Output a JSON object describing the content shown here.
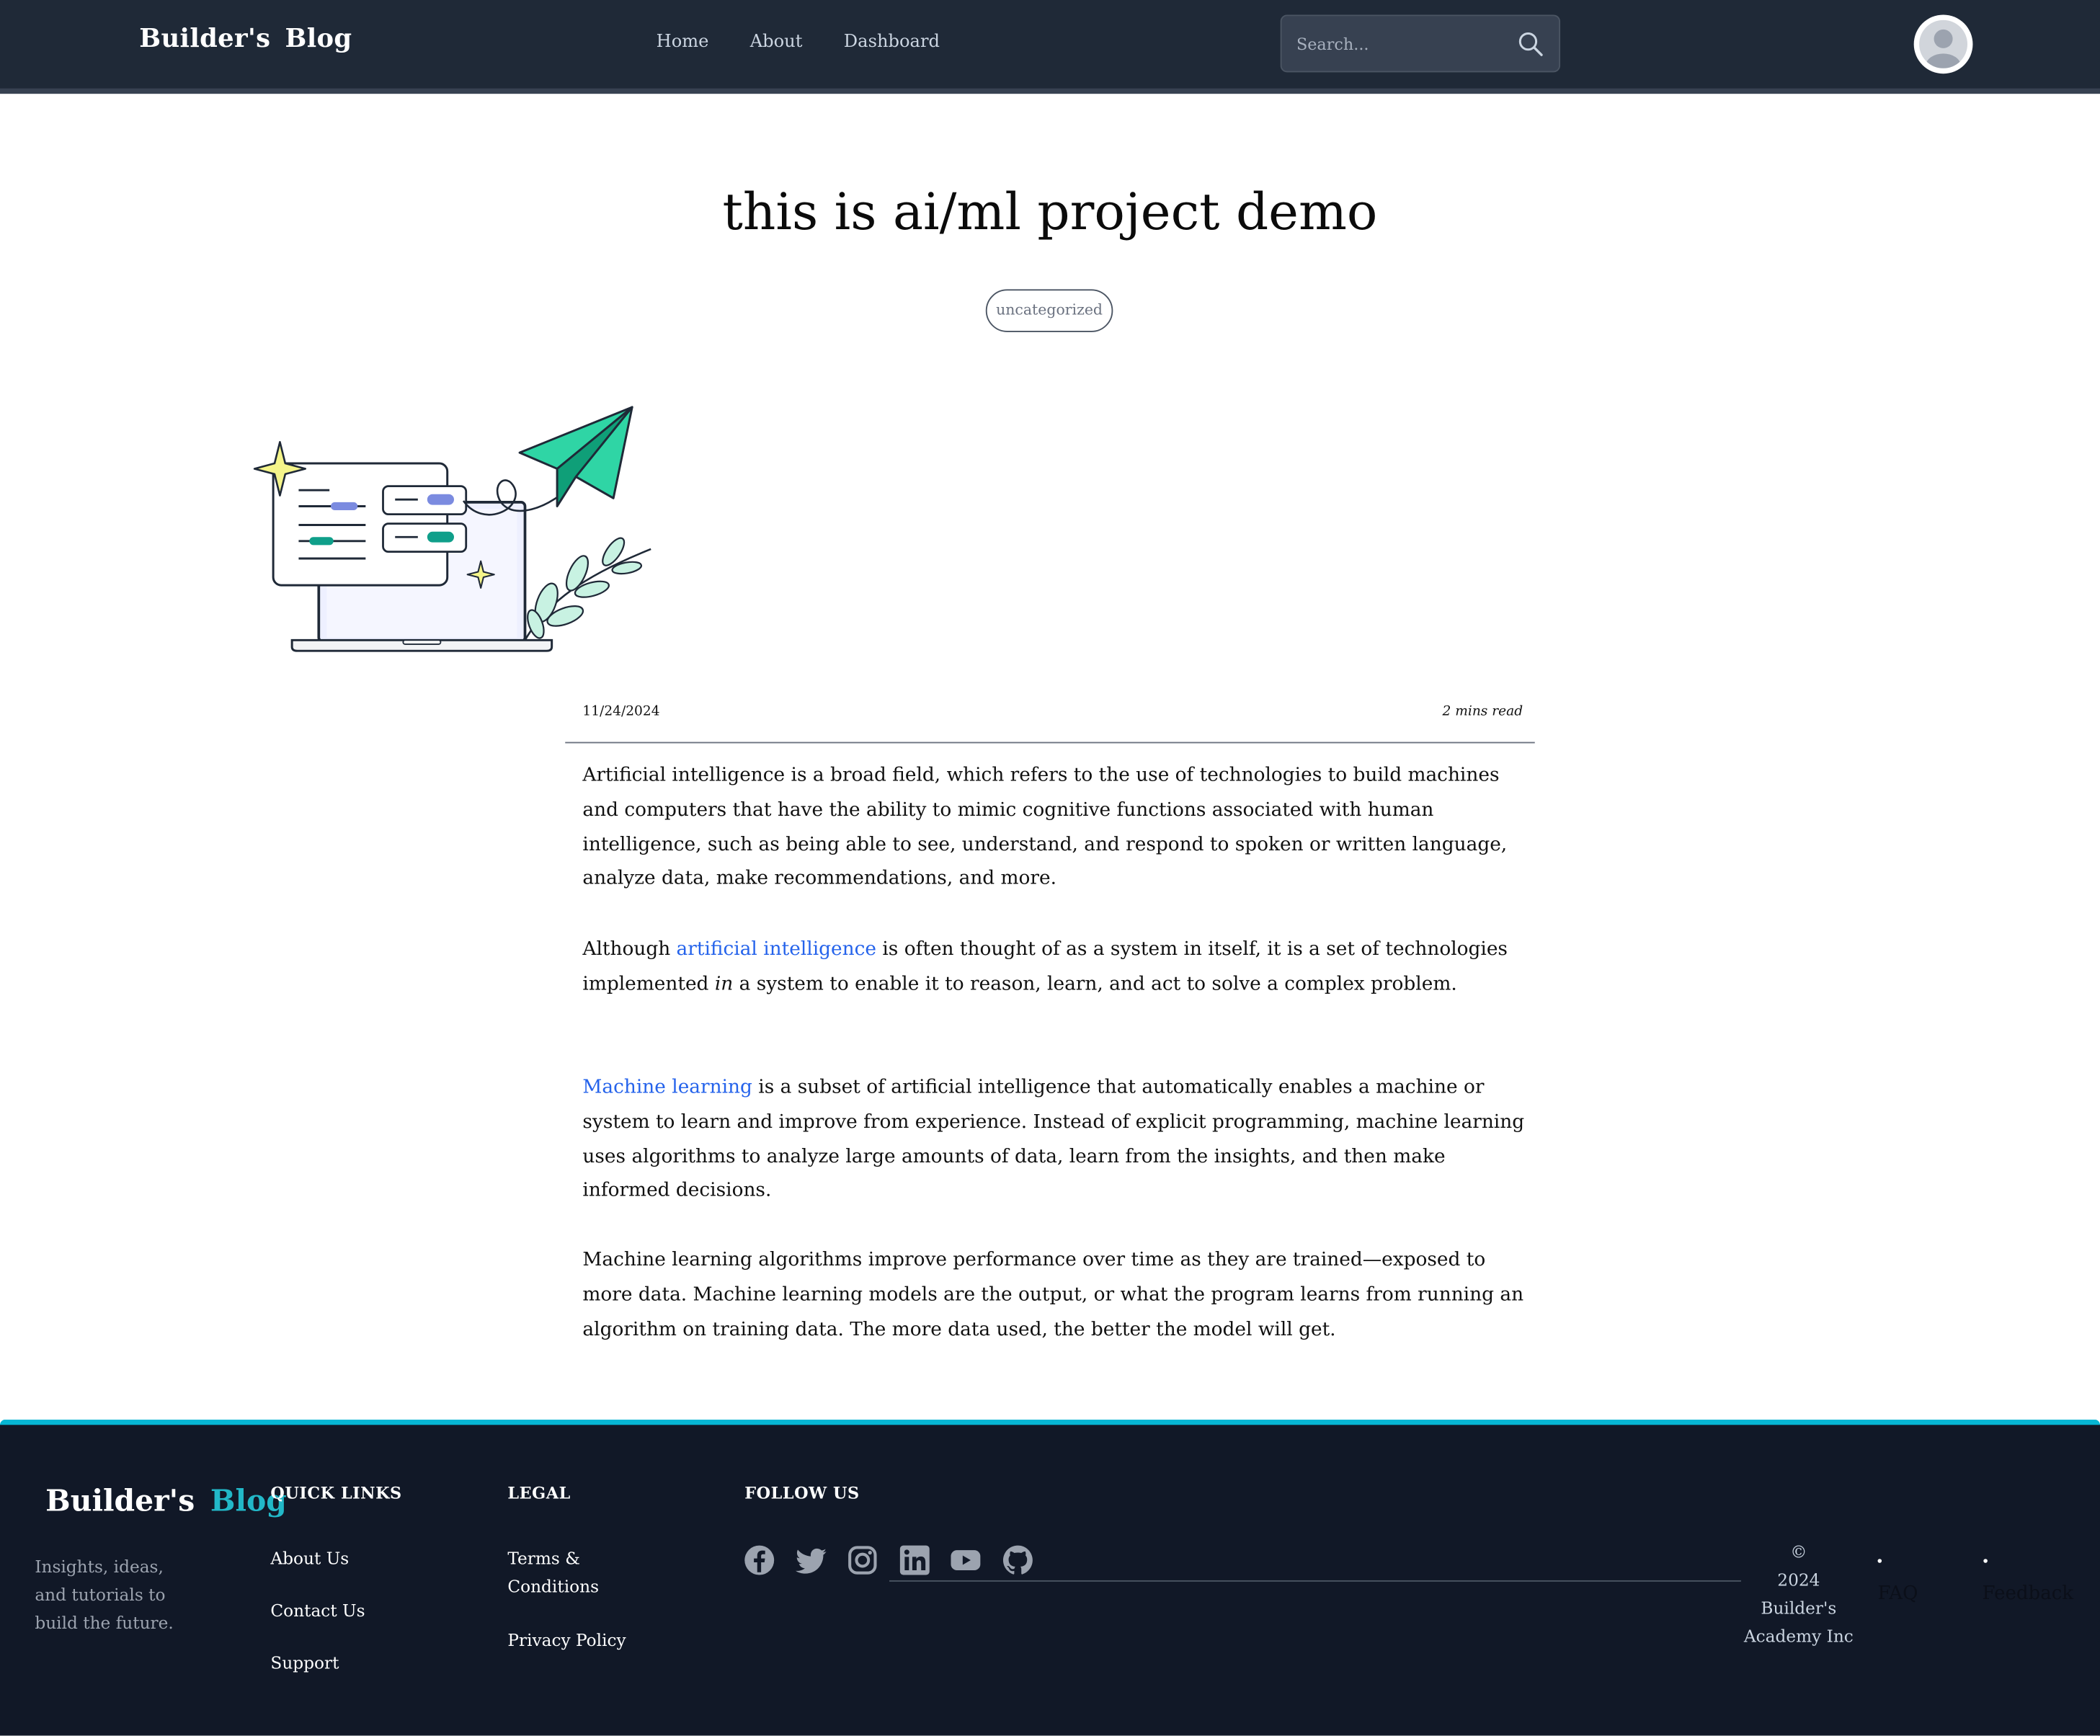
{
  "header": {
    "brand": "Builder's Blog",
    "nav": [
      "Home",
      "About",
      "Dashboard"
    ],
    "search_placeholder": "Search..."
  },
  "article": {
    "title": "this is ai/ml project demo",
    "tag": "uncategorized",
    "date": "11/24/2024",
    "read_time": "2 mins read",
    "p1": "Artificial intelligence is a broad field, which refers to the use of technologies to build machines and computers that have the ability to mimic cognitive functions associated with human intelligence, such as being able to see, understand, and respond to spoken or written language, analyze data, make recommendations, and more.",
    "p2_before": "Although ",
    "p2_link": "artificial intelligence",
    "p2_mid": " is often thought of as a system in itself, it is a set of technologies implemented ",
    "p2_em": "in",
    "p2_after": " a system to enable it to reason, learn, and act to solve a complex problem.",
    "p3_link": "Machine learning",
    "p3_after": " is a subset of artificial intelligence that automatically enables a machine or system to learn and improve from experience. Instead of explicit programming, machine learning uses algorithms to analyze large amounts of data, learn from the insights, and then make informed decisions.",
    "p4": "Machine learning algorithms improve performance over time as they are trained—exposed to more data. Machine learning models are the output, or what the program learns from running an algorithm on training data. The more data used, the better the model will get."
  },
  "footer": {
    "brand_part1": "Builder's",
    "brand_part2": "Blog",
    "tagline": "Insights, ideas, and tutorials to build the future.",
    "quick_links_heading": "QUICK LINKS",
    "quick_links": [
      "About Us",
      "Contact Us",
      "Support"
    ],
    "legal_heading": "LEGAL",
    "legal_links": [
      "Terms & Conditions",
      "Privacy Policy"
    ],
    "follow_heading": "FOLLOW US",
    "social_icons": [
      "facebook-icon",
      "twitter-icon",
      "instagram-icon",
      "linkedin-icon",
      "youtube-icon",
      "github-icon"
    ],
    "copyright_symbol": "©",
    "copyright_text": "2024 Builder's Academy Inc",
    "extra_links": [
      "FAQ",
      "Feedback"
    ]
  },
  "colors": {
    "nav_bg": "#1f2937",
    "footer_bg": "#111827",
    "footer_accent": "#06b6d4",
    "link": "#2563eb"
  }
}
